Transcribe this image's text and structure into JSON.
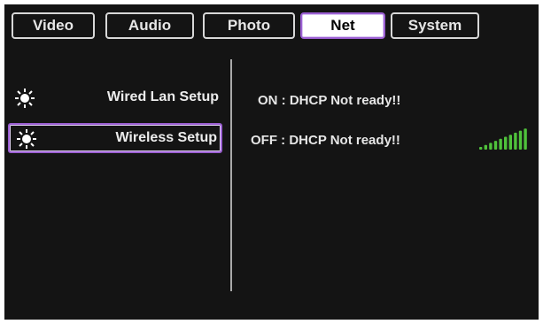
{
  "tabs": [
    {
      "label": "Video",
      "active": false
    },
    {
      "label": "Audio",
      "active": false
    },
    {
      "label": "Photo",
      "active": false
    },
    {
      "label": "Net",
      "active": true
    },
    {
      "label": "System",
      "active": false
    }
  ],
  "menu": {
    "items": [
      {
        "label": "Wired Lan Setup",
        "icon": "sun-icon",
        "selected": false
      },
      {
        "label": "Wireless Setup",
        "icon": "sun-icon",
        "selected": true
      }
    ]
  },
  "status": {
    "wired": "ON : DHCP Not ready!!",
    "wireless": "OFF : DHCP Not ready!!"
  },
  "signal": {
    "icon": "signal-strength-icon",
    "bars": 10,
    "color": "#4fc23b"
  },
  "colors": {
    "accent": "#9b5fd2",
    "background": "#141414",
    "text": "#e6e6e6"
  }
}
